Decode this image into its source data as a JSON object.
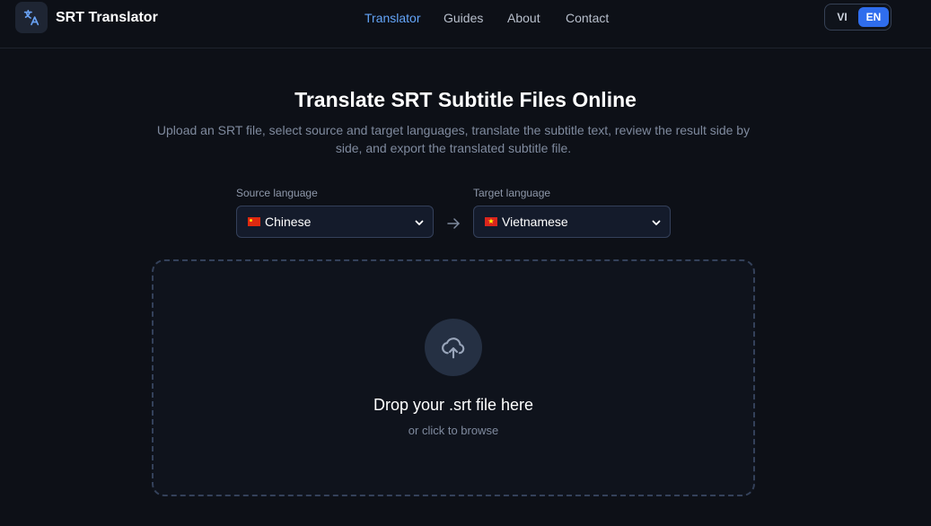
{
  "header": {
    "app_title": "SRT Translator",
    "logo_icon": "translate-icon",
    "nav": [
      {
        "label": "Translator",
        "active": true
      },
      {
        "label": "Guides",
        "active": false
      },
      {
        "label": "About",
        "active": false
      },
      {
        "label": "Contact",
        "active": false
      }
    ],
    "lang_toggle": {
      "options": [
        "VI",
        "EN"
      ],
      "selected": "EN"
    }
  },
  "hero": {
    "title": "Translate SRT Subtitle Files Online",
    "subtitle": "Upload an SRT file, select source and target languages, translate the subtitle text, review the result side by side, and export the translated subtitle file."
  },
  "languages": {
    "source_label": "Source language",
    "source_value": "Chinese",
    "target_label": "Target language",
    "target_value": "Vietnamese"
  },
  "dropzone": {
    "title": "Drop your .srt file here",
    "subtitle": "or click to browse",
    "icon": "cloud-upload-icon"
  },
  "colors": {
    "background": "#0d1017",
    "accent": "#2f6ded",
    "nav_active": "#63a4f8"
  }
}
